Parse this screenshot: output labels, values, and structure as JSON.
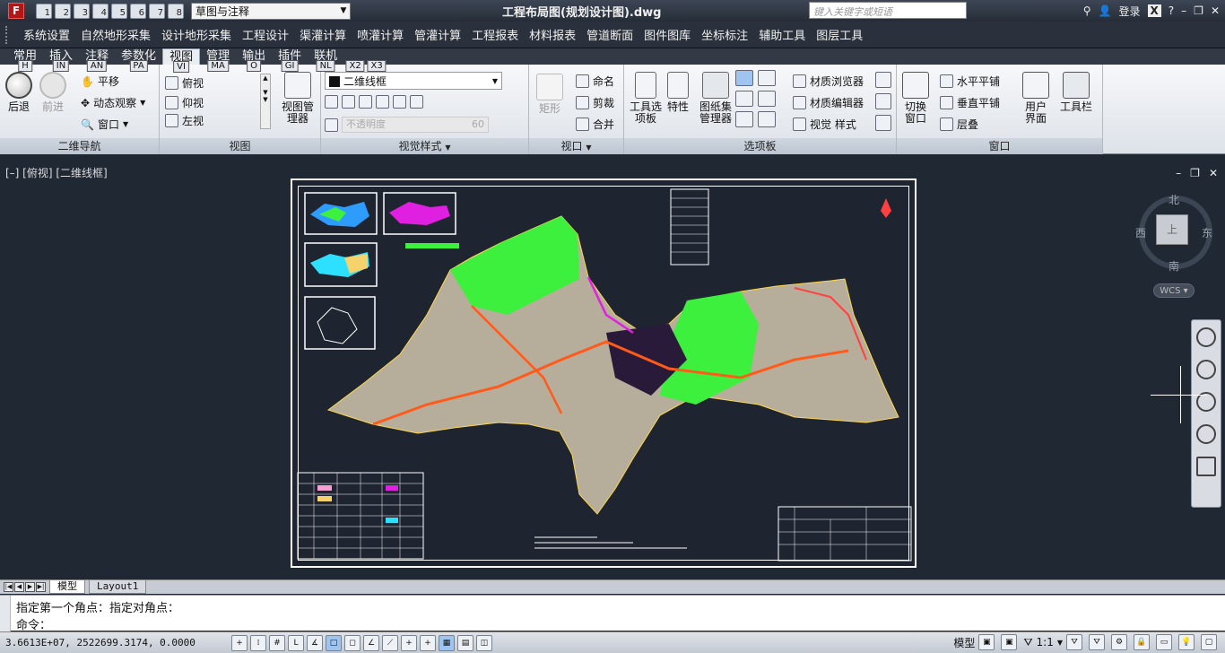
{
  "titlebar": {
    "app_logo": "F",
    "qat_numbers": [
      "1",
      "2",
      "3",
      "4",
      "5",
      "6",
      "7",
      "8"
    ],
    "workspace": "草图与注释",
    "title": "工程布局图(规划设计图).dwg",
    "search_placeholder": "键入关键字或短语",
    "login": "登录",
    "help": "?"
  },
  "menubar": [
    "系统设置",
    "自然地形采集",
    "设计地形采集",
    "工程设计",
    "渠灌计算",
    "喷灌计算",
    "管灌计算",
    "工程报表",
    "材料报表",
    "管道断面",
    "图件图库",
    "坐标标注",
    "辅助工具",
    "图层工具"
  ],
  "tabs": [
    {
      "label": "常用",
      "key": "H"
    },
    {
      "label": "插入",
      "key": "IN"
    },
    {
      "label": "注释",
      "key": "AN"
    },
    {
      "label": "参数化",
      "key": "PA"
    },
    {
      "label": "视图",
      "key": "VI"
    },
    {
      "label": "管理",
      "key": "MA"
    },
    {
      "label": "输出",
      "key": "O"
    },
    {
      "label": "插件",
      "key": "GI"
    },
    {
      "label": "联机",
      "key": "NL"
    },
    {
      "label": "",
      "key": "X2"
    },
    {
      "label": "",
      "key": "X3"
    }
  ],
  "ribbon": {
    "nav2d": {
      "label": "二维导航",
      "back": "后退",
      "forward": "前进",
      "pan": "平移",
      "orbit": "动态观察",
      "window": "窗口"
    },
    "views": {
      "label": "视图",
      "top": "俯视",
      "bottom": "仰视",
      "left": "左视",
      "manager": "视图管理器"
    },
    "visual": {
      "label": "视觉样式",
      "style": "二维线框",
      "opacity": "不透明度",
      "opacity_value": "60"
    },
    "viewports": {
      "label": "视口",
      "rect": "矩形",
      "name": "命名",
      "clip": "剪裁",
      "join": "合并"
    },
    "palettes": {
      "label": "选项板",
      "tool": "工具选项板",
      "props": "特性",
      "sheetset": "图纸集管理器",
      "mat_browser": "材质浏览器",
      "mat_editor": "材质编辑器",
      "visual_styles": "视觉 样式"
    },
    "window": {
      "label": "窗口",
      "switch": "切换窗口",
      "tile_h": "水平平铺",
      "tile_v": "垂直平铺",
      "cascade": "层叠",
      "ui": "用户界面",
      "toolbars": "工具栏"
    }
  },
  "viewport": {
    "label": "[–] [俯视] [二维线框]"
  },
  "viewcube": {
    "north": "北",
    "south": "南",
    "east": "东",
    "west": "西",
    "face": "上",
    "wcs": "WCS"
  },
  "layout_tabs": [
    "模型",
    "Layout1"
  ],
  "command": {
    "history": "指定第一个角点：指定对角点：",
    "prompt": "命令："
  },
  "status": {
    "coords": "3.6613E+07, 2522699.3174, 0.0000",
    "model": "模型",
    "scale": "1:1"
  }
}
